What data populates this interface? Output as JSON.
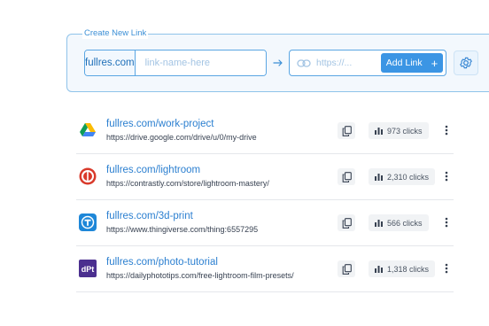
{
  "create_link": {
    "legend": "Create New Link",
    "domain": "fullres.com",
    "slug_placeholder": "link-name-here",
    "url_placeholder": "https://...",
    "add_button_label": "Add Link",
    "add_button_icon": "plus-icon",
    "settings_icon": "gear-icon",
    "accent_color": "#3b95e4"
  },
  "links": [
    {
      "short_url": "fullres.com/work-project",
      "long_url": "https://drive.google.com/drive/u/0/my-drive",
      "clicks": "973 clicks",
      "favicon": "google-drive-icon"
    },
    {
      "short_url": "fullres.com/lightroom",
      "long_url": "https://contrastly.com/store/lightroom-mastery/",
      "clicks": "2,310 clicks",
      "favicon": "contrastly-icon"
    },
    {
      "short_url": "fullres.com/3d-print",
      "long_url": "https://www.thingiverse.com/thing:6557295",
      "clicks": "566 clicks",
      "favicon": "thingiverse-icon"
    },
    {
      "short_url": "fullres.com/photo-tutorial",
      "long_url": "https://dailyphototips.com/free-lightroom-film-presets/",
      "clicks": "1,318 clicks",
      "favicon": "dpt-icon",
      "favicon_text": "dPt"
    }
  ]
}
